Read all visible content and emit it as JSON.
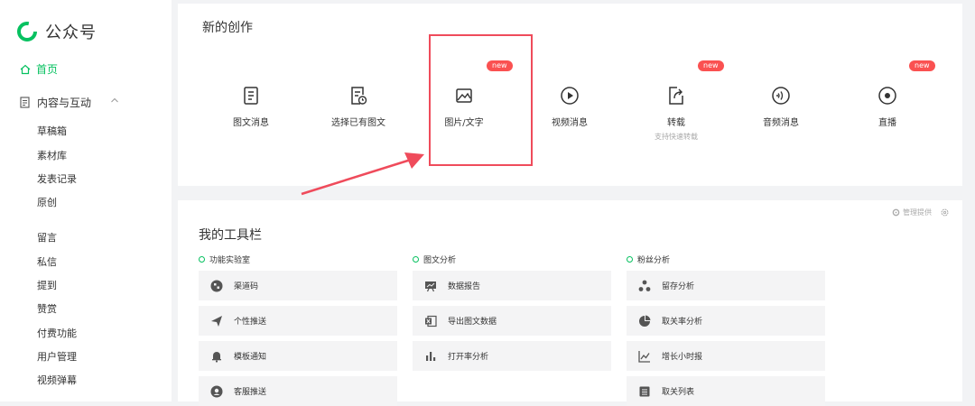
{
  "app": {
    "title": "公众号"
  },
  "nav": {
    "home": "首页",
    "group": "内容与互动",
    "sub1": [
      "草稿箱",
      "素材库",
      "发表记录",
      "原创"
    ],
    "sub2": [
      "留言",
      "私信",
      "提到",
      "赞赏",
      "付费功能",
      "用户管理",
      "视频弹幕"
    ]
  },
  "creation": {
    "title": "新的创作",
    "badge": "new",
    "items": [
      {
        "label": "图文消息",
        "icon": "article-icon"
      },
      {
        "label": "选择已有图文",
        "icon": "history-article-icon"
      },
      {
        "label": "图片/文字",
        "icon": "image-icon"
      },
      {
        "label": "视频消息",
        "icon": "play-icon"
      },
      {
        "label": "转载",
        "sub": "支持快速转载",
        "icon": "repost-icon"
      },
      {
        "label": "音频消息",
        "icon": "audio-icon"
      },
      {
        "label": "直播",
        "icon": "live-icon"
      }
    ]
  },
  "toolbar": {
    "title": "我的工具栏",
    "settings_label": "管理提供",
    "categories": [
      {
        "name": "功能实验室",
        "tools": [
          "渠道码",
          "个性推送",
          "模板通知",
          "客服推送"
        ]
      },
      {
        "name": "图文分析",
        "tools": [
          "数据报告",
          "导出图文数据",
          "打开率分析"
        ]
      },
      {
        "name": "粉丝分析",
        "tools": [
          "留存分析",
          "取关率分析",
          "增长小时报",
          "取关列表"
        ]
      }
    ]
  },
  "colors": {
    "accent": "#07c160",
    "badge": "#fa5151",
    "highlight": "#ef4b5b"
  }
}
